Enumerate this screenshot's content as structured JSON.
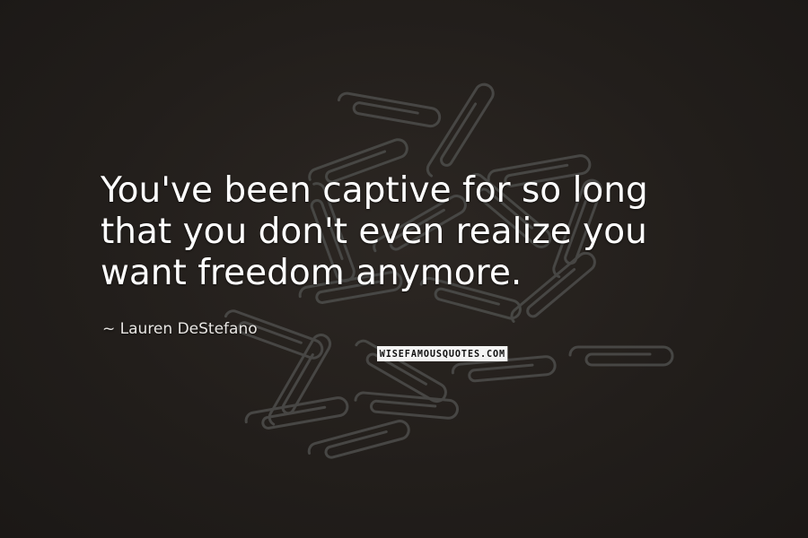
{
  "quote": {
    "lines": [
      "You've been captive for so long",
      "that you don't even realize you",
      "want freedom anymore."
    ]
  },
  "author": {
    "dash": "~",
    "name": "Lauren DeStefano"
  },
  "watermark": "WISEFAMOUSQUOTES.COM",
  "colors": {
    "background": "#231f1c",
    "paperclip": "#4a4a48",
    "text": "#ffffff"
  }
}
